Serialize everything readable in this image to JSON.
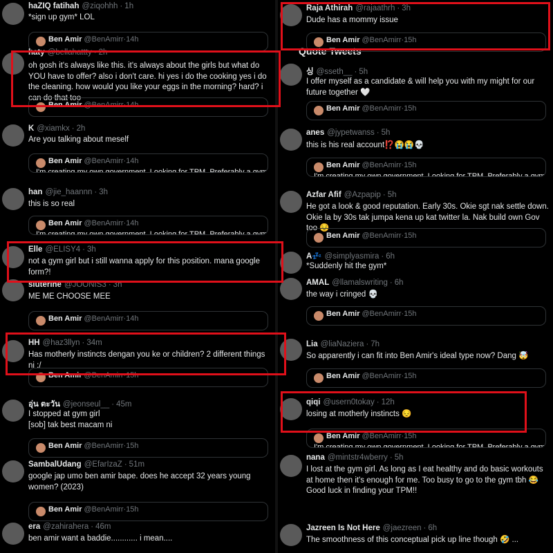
{
  "quoted_account": {
    "name": "Ben Amir",
    "handle": "@BenAmirr",
    "quote_text": "I'm creating my own government. Looking for TPM. Preferably a gym"
  },
  "section_title": "Quote Tweets",
  "left": [
    {
      "name": "haZIQ fatihah",
      "handle": "@ziqohhh",
      "time": "1h",
      "text": "*sign up gym* LOL",
      "quote_time": "14h",
      "quote_text": ""
    },
    {
      "name": "haty",
      "handle": "@bellahattty",
      "time": "2h",
      "text": "oh gosh it's always like this. it's always about the girls but what do YOU have to offer? also i don't care. hi yes i do the cooking yes i do the cleaning. how would you like your eggs in the morning? hard? i can do that too",
      "quote_time": "14h",
      "quote_text": ""
    },
    {
      "name": "K",
      "handle": "@xiamkx",
      "time": "2h",
      "text": "Are you talking about meself",
      "quote_time": "14h",
      "quote_text": "I'm creating my own government. Looking for TPM. Preferably a gym"
    },
    {
      "name": "han",
      "handle": "@jie_haannn",
      "time": "3h",
      "text": "this is so real",
      "quote_time": "14h",
      "quote_text": "I'm creating my own government. Looking for TPM. Preferably a gym"
    },
    {
      "name": "Elle",
      "handle": "@ELISY4",
      "time": "3h",
      "text": "not a gym girl but i still wanna apply for this position. mana google form?!",
      "quote_time": "",
      "quote_text": ""
    },
    {
      "name": "siuterine",
      "handle": "@JOONIS3",
      "time": "3h",
      "text": "ME ME CHOOSE MEE",
      "quote_time": "14h",
      "quote_text": ""
    },
    {
      "name": "HH",
      "handle": "@haz3llyn",
      "time": "34m",
      "text": "Has motherly instincts dengan you ke or children? 2 different things ni :/",
      "quote_time": "15h",
      "quote_text": ""
    },
    {
      "name": "อุ่น ตะวัน",
      "handle": "@jeonseul__",
      "time": "45m",
      "text": "I stopped at gym girl\n[sob] tak best macam ni",
      "quote_time": "15h",
      "quote_text": ""
    },
    {
      "name": "SambalŮdang",
      "handle": "@EfarIzaZ",
      "time": "51m",
      "text": "google jap umo ben amir bape. does he accept 32 years young women? (2023)",
      "quote_time": "15h",
      "quote_text": ""
    },
    {
      "name": "era",
      "handle": "@zahirahera",
      "time": "46m",
      "text": "ben amir want a baddie............ i mean....",
      "quote_time": "",
      "quote_text": ""
    }
  ],
  "right": [
    {
      "name": "Raja Athirah",
      "handle": "@rajaathrh",
      "time": "3h",
      "text": "Dude has a mommy issue",
      "quote_time": "15h",
      "quote_text": ""
    },
    {
      "name": "싱",
      "handle": "@sseth__",
      "time": "5h",
      "text": "I offer myself as a candidate & will help you with my might for our future together 🤍",
      "quote_time": "15h",
      "quote_text": ""
    },
    {
      "name": "anes",
      "handle": "@jypetwanss",
      "time": "5h",
      "text": "this is his real account⁉️😭😭💀",
      "quote_time": "15h",
      "quote_text": "I'm creating my own government. Looking for TPM. Preferably a gym"
    },
    {
      "name": "Azfar Afif",
      "handle": "@Azpapip",
      "time": "5h",
      "text": "He got a look & good reputation. Early 30s. Okie sgt nak settle down. Okie la by 30s tak jumpa kena up kat twitter la. Nak build own Gov too 😌",
      "quote_time": "15h",
      "quote_text": ""
    },
    {
      "name": "A💤",
      "handle": "@simplyasmira",
      "time": "6h",
      "text": "*Suddenly hit the gym*",
      "quote_time": "",
      "quote_text": ""
    },
    {
      "name": "AMAL",
      "handle": "@llamalswriting",
      "time": "6h",
      "text": "the way i cringed 💀",
      "quote_time": "15h",
      "quote_text": ""
    },
    {
      "name": "Lia",
      "handle": "@liaNaziera",
      "time": "7h",
      "text": "So apparently i can fit into Ben Amir's ideal type now? Dang 🤯",
      "quote_time": "15h",
      "quote_text": ""
    },
    {
      "name": "qiqi",
      "handle": "@usern0tokay",
      "time": "12h",
      "text": "losing at motherly instincts 😔",
      "quote_time": "15h",
      "quote_text": "I'm creating my own government. Looking for TPM. Preferably a gym"
    },
    {
      "name": "nana",
      "handle": "@mintstr4wberry",
      "time": "5h",
      "text": "I lost at the gym girl. As long as I eat healthy and do basic workouts at home then it's enough for me. Too busy to go to the gym tbh 😂 Good luck in finding your TPM!!",
      "quote_time": "",
      "quote_text": ""
    },
    {
      "name": "Jazreen Is Not Here",
      "handle": "@jaezreen",
      "time": "6h",
      "text": "The smoothness of this conceptual pick up line though 🤣 ...",
      "quote_time": "",
      "quote_text": ""
    }
  ],
  "colors": {
    "background": "#000000",
    "text": "#e7e9ea",
    "muted": "#71767b",
    "border": "#2f3336",
    "highlight": "#e0101a"
  }
}
